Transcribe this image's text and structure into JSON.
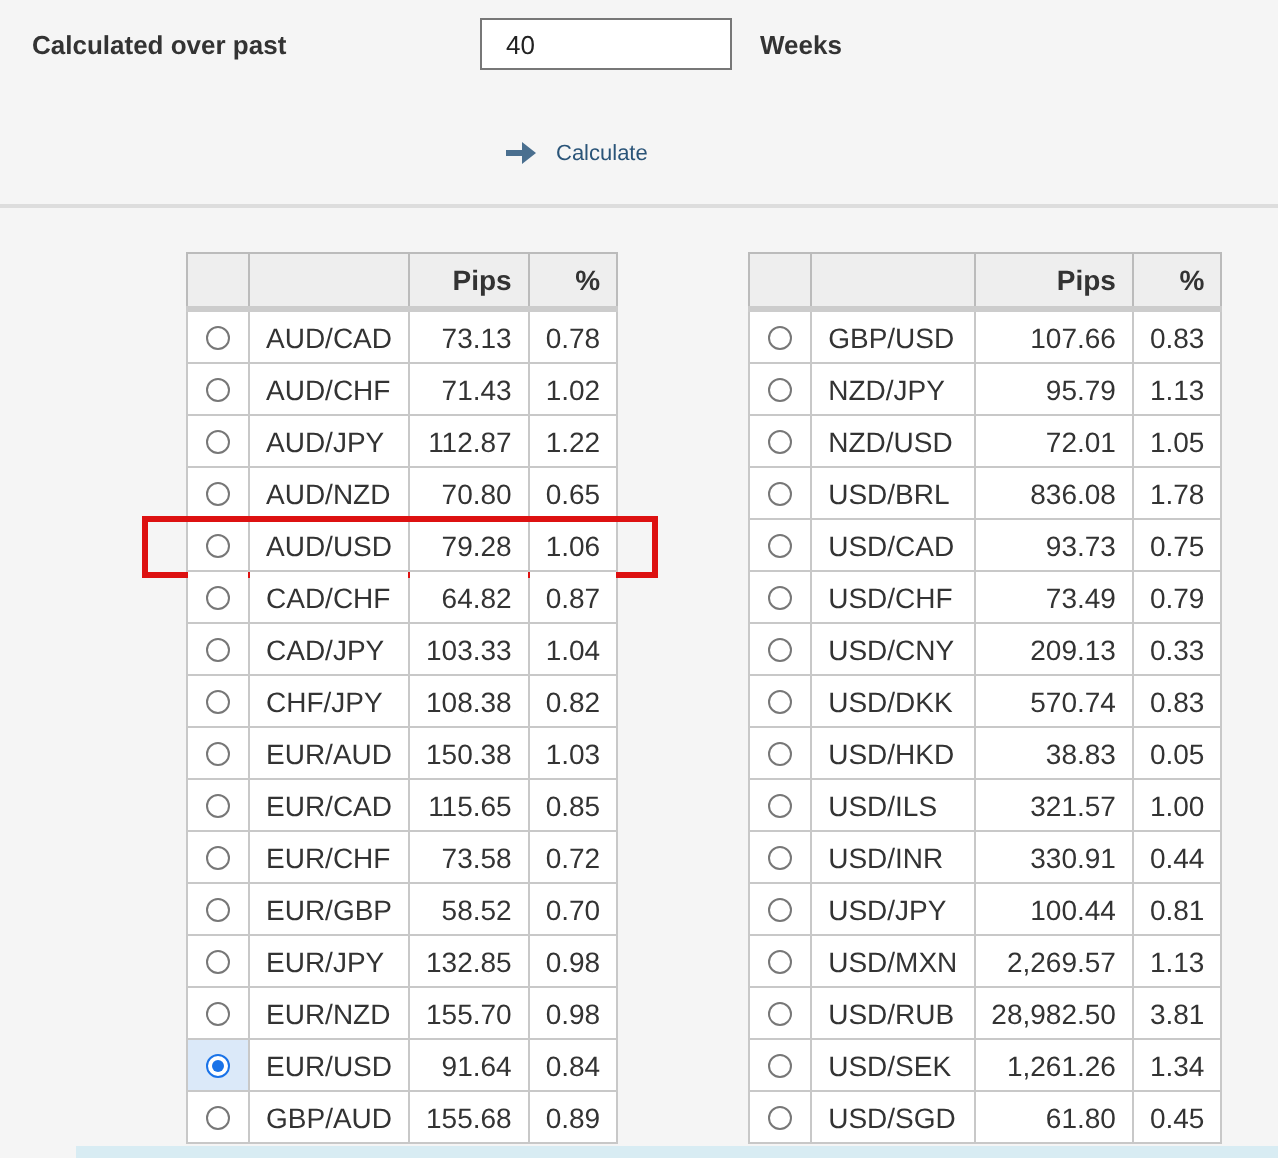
{
  "form": {
    "label": "Calculated over past",
    "value": "40",
    "unit": "Weeks",
    "button": "Calculate"
  },
  "tables": [
    {
      "columns": [
        "",
        "",
        "Pips",
        "%"
      ],
      "rows": [
        {
          "pair": "AUD/CAD",
          "pips": "73.13",
          "pct": "0.78",
          "selected": false,
          "highlighted": false
        },
        {
          "pair": "AUD/CHF",
          "pips": "71.43",
          "pct": "1.02",
          "selected": false,
          "highlighted": false
        },
        {
          "pair": "AUD/JPY",
          "pips": "112.87",
          "pct": "1.22",
          "selected": false,
          "highlighted": false
        },
        {
          "pair": "AUD/NZD",
          "pips": "70.80",
          "pct": "0.65",
          "selected": false,
          "highlighted": false
        },
        {
          "pair": "AUD/USD",
          "pips": "79.28",
          "pct": "1.06",
          "selected": false,
          "highlighted": true
        },
        {
          "pair": "CAD/CHF",
          "pips": "64.82",
          "pct": "0.87",
          "selected": false,
          "highlighted": false
        },
        {
          "pair": "CAD/JPY",
          "pips": "103.33",
          "pct": "1.04",
          "selected": false,
          "highlighted": false
        },
        {
          "pair": "CHF/JPY",
          "pips": "108.38",
          "pct": "0.82",
          "selected": false,
          "highlighted": false
        },
        {
          "pair": "EUR/AUD",
          "pips": "150.38",
          "pct": "1.03",
          "selected": false,
          "highlighted": false
        },
        {
          "pair": "EUR/CAD",
          "pips": "115.65",
          "pct": "0.85",
          "selected": false,
          "highlighted": false
        },
        {
          "pair": "EUR/CHF",
          "pips": "73.58",
          "pct": "0.72",
          "selected": false,
          "highlighted": false
        },
        {
          "pair": "EUR/GBP",
          "pips": "58.52",
          "pct": "0.70",
          "selected": false,
          "highlighted": false
        },
        {
          "pair": "EUR/JPY",
          "pips": "132.85",
          "pct": "0.98",
          "selected": false,
          "highlighted": false
        },
        {
          "pair": "EUR/NZD",
          "pips": "155.70",
          "pct": "0.98",
          "selected": false,
          "highlighted": false
        },
        {
          "pair": "EUR/USD",
          "pips": "91.64",
          "pct": "0.84",
          "selected": true,
          "highlighted": false
        },
        {
          "pair": "GBP/AUD",
          "pips": "155.68",
          "pct": "0.89",
          "selected": false,
          "highlighted": false
        }
      ]
    },
    {
      "columns": [
        "",
        "",
        "Pips",
        "%"
      ],
      "rows": [
        {
          "pair": "GBP/USD",
          "pips": "107.66",
          "pct": "0.83",
          "selected": false,
          "highlighted": false
        },
        {
          "pair": "NZD/JPY",
          "pips": "95.79",
          "pct": "1.13",
          "selected": false,
          "highlighted": false
        },
        {
          "pair": "NZD/USD",
          "pips": "72.01",
          "pct": "1.05",
          "selected": false,
          "highlighted": false
        },
        {
          "pair": "USD/BRL",
          "pips": "836.08",
          "pct": "1.78",
          "selected": false,
          "highlighted": false
        },
        {
          "pair": "USD/CAD",
          "pips": "93.73",
          "pct": "0.75",
          "selected": false,
          "highlighted": false
        },
        {
          "pair": "USD/CHF",
          "pips": "73.49",
          "pct": "0.79",
          "selected": false,
          "highlighted": false
        },
        {
          "pair": "USD/CNY",
          "pips": "209.13",
          "pct": "0.33",
          "selected": false,
          "highlighted": false
        },
        {
          "pair": "USD/DKK",
          "pips": "570.74",
          "pct": "0.83",
          "selected": false,
          "highlighted": false
        },
        {
          "pair": "USD/HKD",
          "pips": "38.83",
          "pct": "0.05",
          "selected": false,
          "highlighted": false
        },
        {
          "pair": "USD/ILS",
          "pips": "321.57",
          "pct": "1.00",
          "selected": false,
          "highlighted": false
        },
        {
          "pair": "USD/INR",
          "pips": "330.91",
          "pct": "0.44",
          "selected": false,
          "highlighted": false
        },
        {
          "pair": "USD/JPY",
          "pips": "100.44",
          "pct": "0.81",
          "selected": false,
          "highlighted": false
        },
        {
          "pair": "USD/MXN",
          "pips": "2,269.57",
          "pct": "1.13",
          "selected": false,
          "highlighted": false
        },
        {
          "pair": "USD/RUB",
          "pips": "28,982.50",
          "pct": "3.81",
          "selected": false,
          "highlighted": false
        },
        {
          "pair": "USD/SEK",
          "pips": "1,261.26",
          "pct": "1.34",
          "selected": false,
          "highlighted": false
        },
        {
          "pair": "USD/SGD",
          "pips": "61.80",
          "pct": "0.45",
          "selected": false,
          "highlighted": false
        }
      ]
    }
  ]
}
